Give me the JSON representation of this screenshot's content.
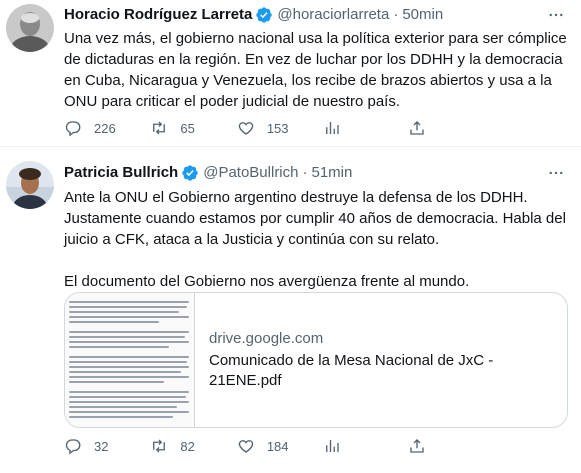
{
  "tweets": [
    {
      "name": "Horacio Rodríguez Larreta",
      "handle": "@horaciorlarreta",
      "separator": "·",
      "time": "50min",
      "text": "Una vez más, el gobierno nacional usa la política exterior para ser cómplice de dictaduras en la región. En vez de luchar por los DDHH y la democracia en Cuba, Nicaragua y Venezuela, los recibe de brazos abiertos y usa a la ONU para criticar el poder judicial de nuestro país.",
      "replies": "226",
      "retweets": "65",
      "likes": "153"
    },
    {
      "name": "Patricia Bullrich",
      "handle": "@PatoBullrich",
      "separator": "·",
      "time": "51min",
      "text": "Ante la ONU el Gobierno argentino destruye la defensa de los DDHH. Justamente cuando estamos por cumplir 40 años de democracia. Habla del juicio a CFK, ataca a la Justicia y continúa con su relato.\n\nEl documento del Gobierno nos avergüenza frente al mundo.",
      "card": {
        "domain": "drive.google.com",
        "title": "Comunicado de la Mesa Nacional de JxC -\n21ENE.pdf"
      },
      "replies": "32",
      "retweets": "82",
      "likes": "184"
    }
  ],
  "icons": {
    "verified": "verified-badge-icon",
    "more": "more-options-icon",
    "reply": "reply-icon",
    "retweet": "retweet-icon",
    "like": "like-icon",
    "analytics": "analytics-icon",
    "share": "share-icon"
  },
  "colors": {
    "text": "#0f1419",
    "secondary": "#536471",
    "verified": "#1d9bf0",
    "border": "#eff3f4"
  }
}
